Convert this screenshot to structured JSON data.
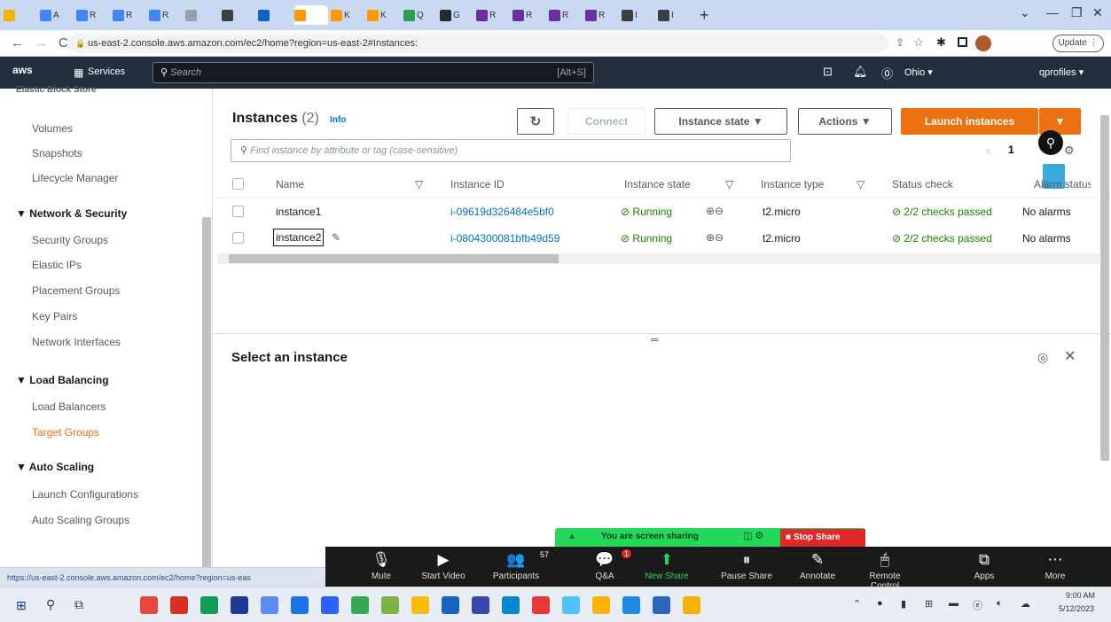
{
  "browser": {
    "tabs": [
      {
        "label": "",
        "color": "#f4b400"
      },
      {
        "label": "A",
        "color": "#4285f4"
      },
      {
        "label": "R",
        "color": "#4285f4"
      },
      {
        "label": "R",
        "color": "#4285f4"
      },
      {
        "label": "R",
        "color": "#4285f4"
      },
      {
        "label": "",
        "color": "#9aa0a6"
      },
      {
        "label": "",
        "color": "#3c4043"
      },
      {
        "label": "",
        "color": "#0a66c2"
      },
      {
        "label": "",
        "color": "#ff9900"
      },
      {
        "label": "K",
        "color": "#ff9900"
      },
      {
        "label": "K",
        "color": "#ff9900"
      },
      {
        "label": "Q",
        "color": "#2b9e53"
      },
      {
        "label": "G",
        "color": "#24292f"
      },
      {
        "label": "R",
        "color": "#6b2fa0"
      },
      {
        "label": "R",
        "color": "#6b2fa0"
      },
      {
        "label": "R",
        "color": "#6b2fa0"
      },
      {
        "label": "R",
        "color": "#6b2fa0"
      },
      {
        "label": "I",
        "color": "#3c4043"
      },
      {
        "label": "I",
        "color": "#3c4043"
      }
    ],
    "new_tab": "+",
    "url": "us-east-2.console.aws.amazon.com/ec2/home?region=us-east-2#Instances:",
    "update_label": "Update",
    "status_url": "https://us-east-2.console.aws.amazon.com/ec2/home?region=us-eas"
  },
  "aws": {
    "logo": "aws",
    "services": "Services",
    "search_placeholder": "Search",
    "search_shortcut": "[Alt+S]",
    "region": "Ohio ▾",
    "account": "qprofiles ▾"
  },
  "sidebar": {
    "cut_item": "Elastic Block Store",
    "items_top": [
      "Volumes",
      "Snapshots",
      "Lifecycle Manager"
    ],
    "network_head": "Network & Security",
    "network_items": [
      "Security Groups",
      "Elastic IPs",
      "Placement Groups",
      "Key Pairs",
      "Network Interfaces"
    ],
    "lb_head": "Load Balancing",
    "lb_items": [
      "Load Balancers",
      "Target Groups"
    ],
    "as_head": "Auto Scaling",
    "as_items": [
      "Launch Configurations",
      "Auto Scaling Groups"
    ]
  },
  "instances": {
    "title": "Instances",
    "count": "(2)",
    "info": "Info",
    "connect": "Connect",
    "state_btn": "Instance state ▼",
    "actions_btn": "Actions ▼",
    "launch_btn": "Launch instances",
    "filter_placeholder": "Find instance by attribute or tag (case-sensitive)",
    "page": "1",
    "columns": [
      "Name",
      "Instance ID",
      "Instance state",
      "Instance type",
      "Status check",
      "Alarm status"
    ],
    "rows": [
      {
        "name": "instance1",
        "id": "i-09619d326484e5bf0",
        "state": "Running",
        "type": "t2.micro",
        "status": "2/2 checks passed",
        "alarm": "No alarms"
      },
      {
        "name": "instance2",
        "id": "i-0804300081bfb49d59",
        "state": "Running",
        "type": "t2.micro",
        "status": "2/2 checks passed",
        "alarm": "No alarms"
      }
    ],
    "select_msg": "Select an instance"
  },
  "zoom": {
    "sharing_msg": "You are screen sharing",
    "stop_share": "Stop Share",
    "participants_count": "57",
    "qa_badge": "1",
    "buttons": [
      "Mute",
      "Start Video",
      "Participants",
      "Q&A",
      "New Share",
      "Pause Share",
      "Annotate",
      "Remote Control",
      "Apps",
      "More"
    ]
  },
  "taskbar": {
    "time": "9:00 AM",
    "date": "5/12/2023"
  },
  "colors": {
    "aws_nav": "#232f3e",
    "launch": "#ec7211",
    "link": "#0073bb",
    "running": "#1d8102",
    "zoom_green": "#23d959",
    "stop_red": "#e02828"
  }
}
